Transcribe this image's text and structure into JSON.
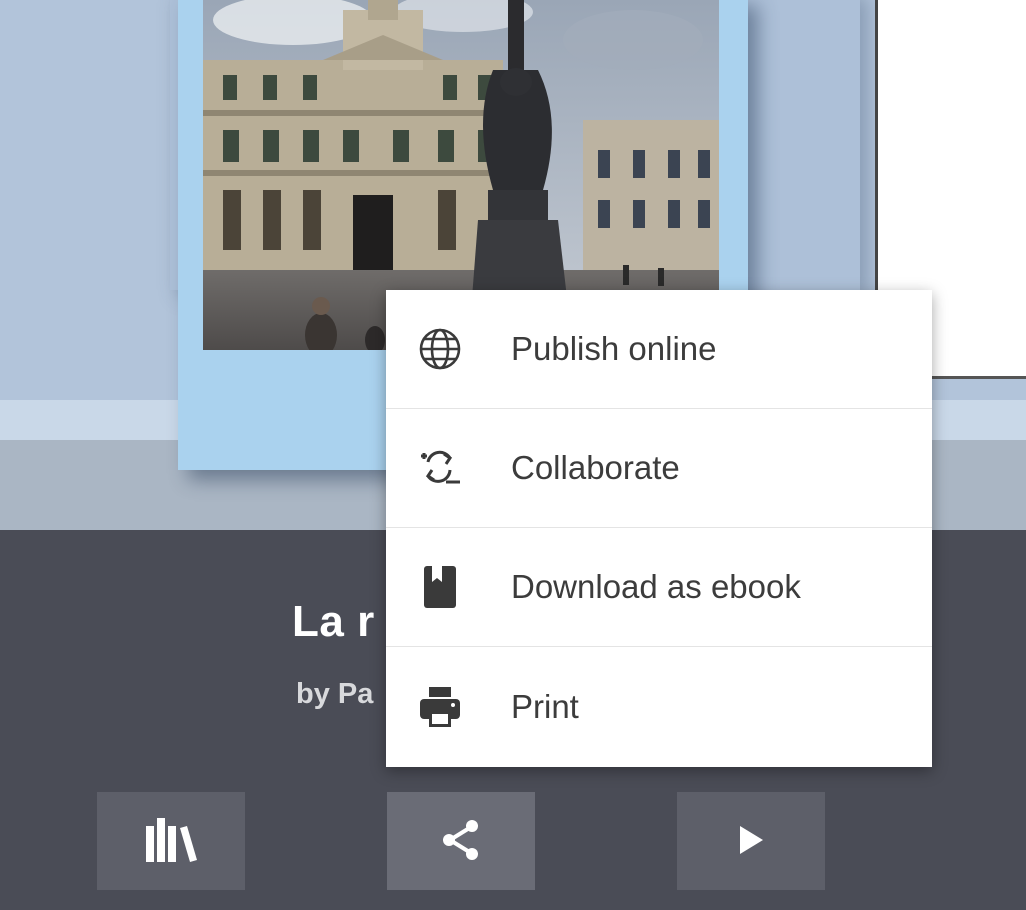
{
  "book": {
    "title": "La r",
    "author": "by Pa"
  },
  "share_menu": {
    "items": [
      {
        "label": "Publish online",
        "icon": "globe-icon"
      },
      {
        "label": "Collaborate",
        "icon": "collaborate-icon"
      },
      {
        "label": "Download as ebook",
        "icon": "ebook-icon"
      },
      {
        "label": "Print",
        "icon": "printer-icon"
      }
    ]
  },
  "toolbar": {
    "buttons": [
      {
        "icon": "library-icon"
      },
      {
        "icon": "share-icon"
      },
      {
        "icon": "play-icon"
      }
    ]
  },
  "colors": {
    "info_background": "#4a4c56",
    "cover_border": "#aad2ee",
    "menu_text": "#3c3c3c"
  }
}
